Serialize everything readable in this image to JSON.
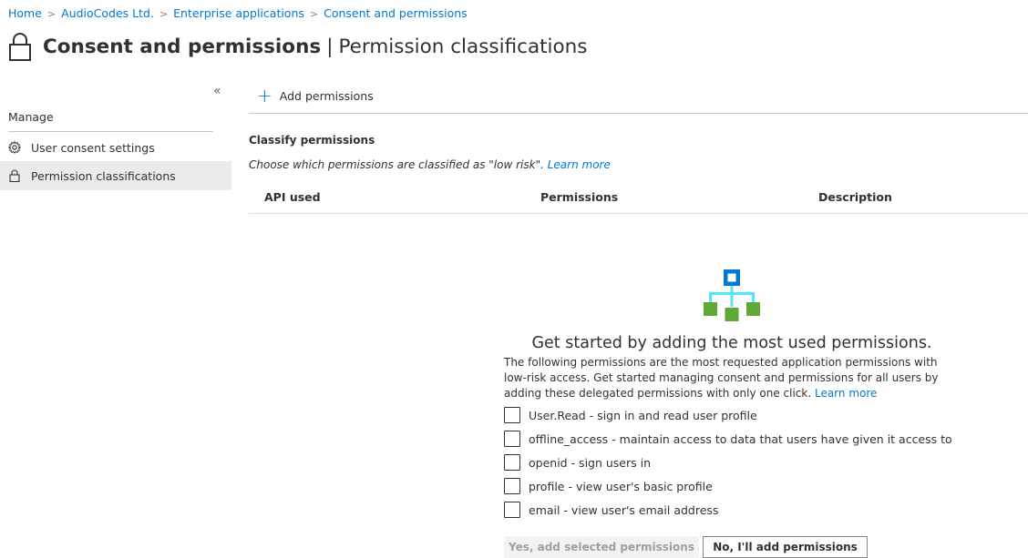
{
  "breadcrumb": {
    "items": [
      "Home",
      "AudioCodes Ltd.",
      "Enterprise applications",
      "Consent and permissions"
    ]
  },
  "header": {
    "title": "Consent and permissions",
    "separator": "|",
    "subtitle": "Permission classifications",
    "icon": "lock-icon"
  },
  "sidebar": {
    "collapse_glyph": "«",
    "heading": "Manage",
    "items": [
      {
        "label": "User consent settings",
        "icon": "gear-icon",
        "active": false
      },
      {
        "label": "Permission classifications",
        "icon": "lock-icon",
        "active": true
      }
    ]
  },
  "toolbar": {
    "add_label": "Add permissions",
    "add_glyph": "+"
  },
  "section": {
    "title": "Classify permissions",
    "description": "Choose which permissions are classified as \"low risk\". ",
    "learn_more": "Learn more"
  },
  "table": {
    "columns": [
      "API used",
      "Permissions",
      "Description"
    ]
  },
  "empty_state": {
    "icon": "hierarchy-icon",
    "title": "Get started by adding the most used permissions.",
    "description": "The following permissions are the most requested application permissions with low-risk access. Get started managing consent and permissions for all users by adding these delegated permissions with only one click. ",
    "learn_more": "Learn more",
    "permissions": [
      {
        "label": "User.Read - sign in and read user profile",
        "checked": false
      },
      {
        "label": "offline_access - maintain access to data that users have given it access to",
        "checked": false
      },
      {
        "label": "openid - sign users in",
        "checked": false
      },
      {
        "label": "profile - view user's basic profile",
        "checked": false
      },
      {
        "label": "email - view user's email address",
        "checked": false
      }
    ],
    "primary_button": "Yes, add selected permissions",
    "secondary_button": "No, I'll add permissions"
  },
  "colors": {
    "accent": "#0078d4",
    "icon_blue": "#0078d4",
    "icon_cyan": "#50e6ff",
    "icon_green": "#5ea835"
  }
}
